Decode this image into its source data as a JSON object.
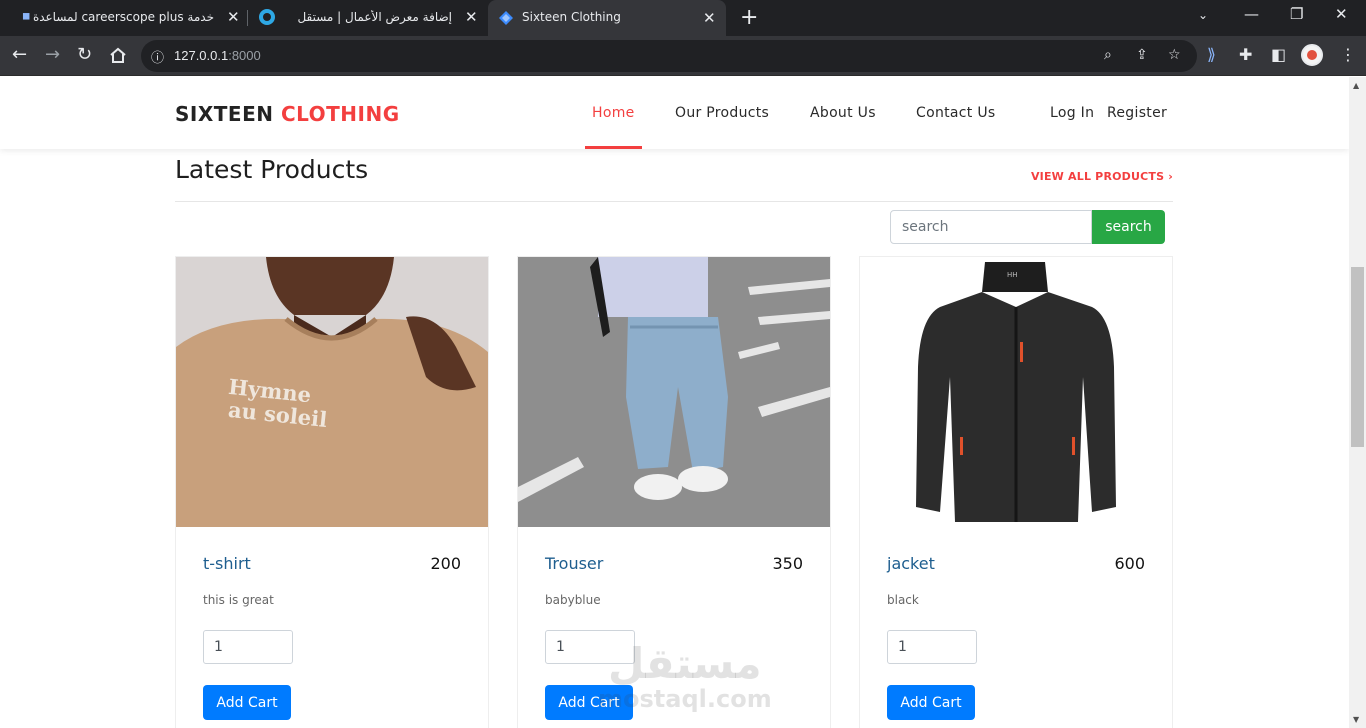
{
  "browser": {
    "tabs": [
      {
        "title": "خدمة careerscope plus لمساعدة",
        "active": false
      },
      {
        "title": "إضافة معرض الأعمال | مستقل",
        "active": false
      },
      {
        "title": "Sixteen Clothing",
        "active": true
      }
    ],
    "url_host": "127.0.0.1",
    "url_port": ":8000",
    "accent": "#35363a"
  },
  "header": {
    "logo_part1": "SIXTEEN",
    "logo_part2": "CLOTHING",
    "menu": [
      {
        "label": "Home",
        "active": true
      },
      {
        "label": "Our Products",
        "active": false
      },
      {
        "label": "About Us",
        "active": false
      },
      {
        "label": "Contact Us",
        "active": false
      },
      {
        "label": "Log In",
        "active": false
      },
      {
        "label": "Register",
        "active": false
      }
    ]
  },
  "main": {
    "title": "Latest Products",
    "view_all": "VIEW ALL PRODUCTS ›",
    "search": {
      "placeholder": "search",
      "button": "search"
    },
    "products": [
      {
        "name": "t-shirt",
        "price": "200",
        "description": "this is great",
        "qty": "1",
        "button": "Add Cart",
        "image": "tshirt-icon"
      },
      {
        "name": "Trouser",
        "price": "350",
        "description": "babyblue",
        "qty": "1",
        "button": "Add Cart",
        "image": "trouser-icon"
      },
      {
        "name": "jacket",
        "price": "600",
        "description": "black",
        "qty": "1",
        "button": "Add Cart",
        "image": "jacket-icon"
      }
    ]
  },
  "watermark": {
    "arabic": "مستقل",
    "latin": "mostaql.com"
  },
  "colors": {
    "brand_red": "#f33f3f",
    "search_green": "#28a745",
    "cart_blue": "#007bff",
    "link_blue": "#1e5e8f"
  }
}
